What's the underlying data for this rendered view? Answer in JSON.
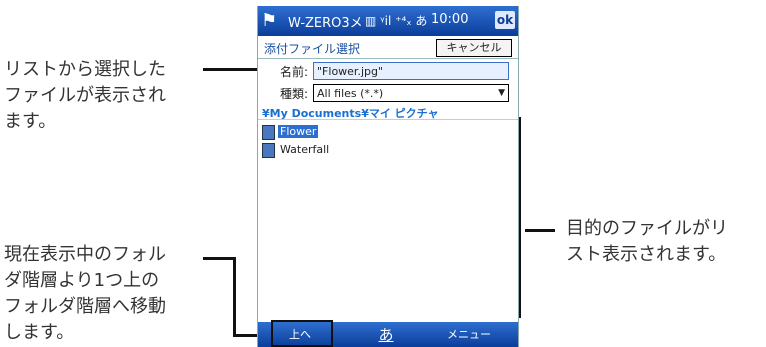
{
  "annotations": {
    "top_left": [
      "リストから選択した",
      "ファイルが表示され",
      "ます。"
    ],
    "right": [
      "目的のファイルがリ",
      "スト表示されます。"
    ],
    "bottom_left": [
      "現在表示中のフォル",
      "ダ階層より1つ上の",
      "フォルダ階層へ移動",
      "します。"
    ]
  },
  "titlebar": {
    "title": "W-ZERO3メ",
    "status_icons": "▥ ᵞil ⁺⁴ₓ あ",
    "time": "10:00",
    "ok_label": "ok"
  },
  "dialog": {
    "title": "添付ファイル選択",
    "cancel_label": "キャンセル",
    "name_label": "名前:",
    "name_value": "\"Flower.jpg\"",
    "type_label": "種類:",
    "type_value": "All files (*.*)",
    "path": "¥My Documents¥マイ ピクチャ"
  },
  "files": [
    {
      "name": "Flower",
      "selected": true
    },
    {
      "name": "Waterfall",
      "selected": false
    }
  ],
  "menubar": {
    "up_label": "上へ",
    "ime_label": "あ",
    "menu_label": "メニュー"
  }
}
